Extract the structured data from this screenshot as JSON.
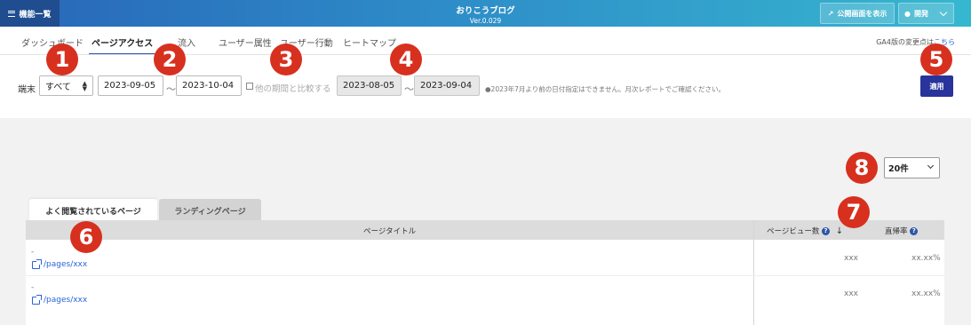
{
  "header": {
    "menu_label": "機能一覧",
    "title": "おりこうブログ",
    "version": "Ver.0.029",
    "public_btn": "公開画面を表示",
    "dev_btn": "開発"
  },
  "nav": {
    "tabs": [
      "ダッシュボード",
      "ページアクセス",
      "流入",
      "ユーザー属性",
      "ユーザー行動",
      "ヒートマップ"
    ],
    "active_index": 1,
    "ga4_text": "GA4版の変更点は",
    "ga4_link": "こちら"
  },
  "filters": {
    "device_label": "端末",
    "device_value": "すべて",
    "start_date": "2023-09-05",
    "end_date": "2023-10-04",
    "tilde": "〜",
    "compare_label": "他の期間と比較する",
    "compare_start": "2023-08-05",
    "compare_end": "2023-09-04",
    "note": "●2023年7月より前の日付指定はできません。月次レポートでご確認ください。",
    "apply_label": "適用"
  },
  "markers": [
    "1",
    "2",
    "3",
    "4",
    "5",
    "6",
    "7",
    "8"
  ],
  "per_page": "20件",
  "content_tabs": [
    "よく閲覧されているページ",
    "ランディングページ"
  ],
  "table": {
    "columns": {
      "title": "ページタイトル",
      "pageviews": "ページビュー数",
      "bounce": "直帰率"
    },
    "help_glyph": "?",
    "sort_glyph": "↓",
    "rows": [
      {
        "title": "-",
        "path": "/pages/xxx",
        "pageviews": "xxx",
        "bounce": "xx.xx%"
      },
      {
        "title": "-",
        "path": "/pages/xxx",
        "pageviews": "xxx",
        "bounce": "xx.xx%"
      }
    ]
  },
  "colors": {
    "header_start": "#2866b8",
    "header_end": "#36b7cf",
    "accent": "#2b56a6",
    "apply": "#28349b",
    "marker": "#d7301f",
    "link": "#2866d9"
  }
}
